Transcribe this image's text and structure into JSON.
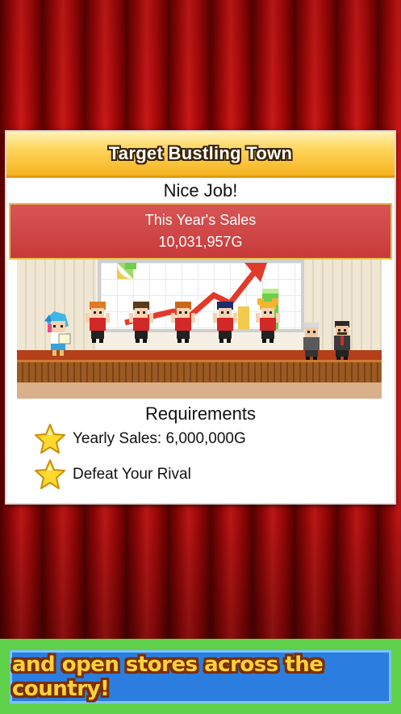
{
  "dialog": {
    "title": "Target Bustling Town",
    "message": "Nice Job!",
    "sales": {
      "label": "This Year's Sales",
      "value": "10,031,957G"
    },
    "requirements": {
      "heading": "Requirements",
      "items": [
        {
          "icon": "star-icon",
          "label": "Yearly Sales: 6,000,000G"
        },
        {
          "icon": "star-icon",
          "label": "Defeat Your Rival"
        }
      ]
    }
  },
  "banner": {
    "text": "and open stores across the country!"
  },
  "colors": {
    "curtain": "#b00a0a",
    "header": "#ffd45a",
    "sales_box": "#c83a3a",
    "banner_bg": "#5fd04a",
    "banner_inner": "#2b7ee0",
    "banner_text": "#ffd23a"
  }
}
